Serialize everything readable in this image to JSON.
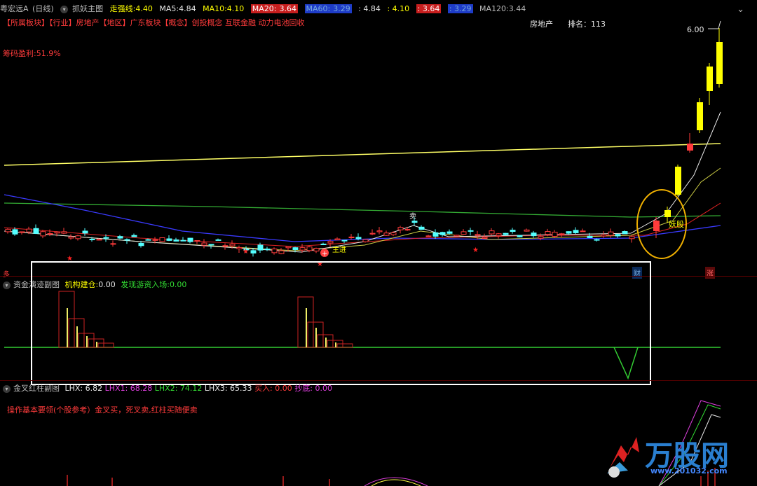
{
  "main": {
    "stock_name": "粤宏远A",
    "period": "(日线)",
    "indicator": "抓妖主图",
    "strong_line": {
      "label": "走强线:",
      "value": "4.40"
    },
    "ma5": {
      "label": "MA5:",
      "value": "4.84"
    },
    "ma10": {
      "label": "MA10:",
      "value": "4.10"
    },
    "ma20": {
      "label": "MA20:",
      "value": "3.64"
    },
    "ma60": {
      "label": "MA60:",
      "value": "3.29"
    },
    "ma_extra_1": ": 4.84",
    "ma_extra_2": ": 4.10",
    "ma_extra_3": ": 3.64",
    "ma_extra_4": ": 3.29",
    "ma120": {
      "label": "MA120:",
      "value": "3.44"
    },
    "sector_line": "【所属板块】【行业】房地产【地区】广东板块【概念】创投概念 互联金融 动力电池回收",
    "profit_label": "筹码盈利:51.9%",
    "industry": "房地产",
    "rank_label": "排名：113",
    "price_high": "6.00",
    "sell_marker": "卖",
    "buy_marker": "主进",
    "yao_marker": "妖股",
    "bottom_left_mark": "多",
    "cai_tag": "财",
    "zhang_tag": "涨",
    "close_symbol": "⌄"
  },
  "sub1": {
    "title": "资金演迹副图",
    "label1": "机构建仓:",
    "value1": "0.00",
    "label2": "发现游资入场:",
    "value2": "0.00"
  },
  "sub2": {
    "title": "金叉红柱副图",
    "lhx": "LHX: 6.82",
    "lhx1": "LHX1: 68.28",
    "lhx2": "LHX2: 74.12",
    "lhx3": "LHX3: 65.33",
    "buy": "买入: 0.00",
    "bottom": "抄底: 0.00",
    "note": "操作基本要领(个股参考）金叉买，死叉卖,红柱买随便卖"
  },
  "watermark": {
    "brand": "万股网",
    "url": "www.201032.com"
  },
  "colors": {
    "bg": "#000000",
    "up": "#ff3b3b",
    "down": "#54ffff",
    "yellow": "#ffff00",
    "green": "#33dd33",
    "blue": "#3a5cff",
    "highlight_box": "#ffffff",
    "oval": "#f0b000"
  },
  "chart_data": {
    "type": "candlestick",
    "notes": "daily K-line with moving averages",
    "price_high_label": 6.0
  }
}
